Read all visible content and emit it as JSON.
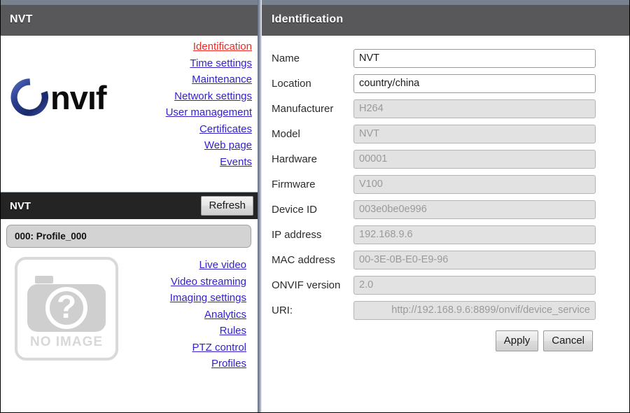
{
  "device_panel": {
    "title": "NVT",
    "logo_text": "Onvif",
    "links": [
      {
        "label": "Identification",
        "active": true
      },
      {
        "label": "Time settings",
        "active": false
      },
      {
        "label": "Maintenance",
        "active": false
      },
      {
        "label": "Network settings",
        "active": false
      },
      {
        "label": "User management",
        "active": false
      },
      {
        "label": "Certificates",
        "active": false
      },
      {
        "label": "Web page",
        "active": false
      },
      {
        "label": "Events",
        "active": false
      }
    ]
  },
  "media_panel": {
    "title": "NVT",
    "refresh_label": "Refresh",
    "profile_selected": "000: Profile_000",
    "no_image_label": "NO IMAGE",
    "links": [
      {
        "label": "Live video"
      },
      {
        "label": "Video streaming"
      },
      {
        "label": "Imaging settings"
      },
      {
        "label": "Analytics"
      },
      {
        "label": "Rules"
      },
      {
        "label": "PTZ control"
      },
      {
        "label": "Profiles"
      }
    ]
  },
  "identification": {
    "title": "Identification",
    "fields": [
      {
        "label": "Name",
        "value": "NVT",
        "readonly": false
      },
      {
        "label": "Location",
        "value": "country/china",
        "readonly": false
      },
      {
        "label": "Manufacturer",
        "value": "H264",
        "readonly": true
      },
      {
        "label": "Model",
        "value": "NVT",
        "readonly": true
      },
      {
        "label": "Hardware",
        "value": "00001",
        "readonly": true
      },
      {
        "label": "Firmware",
        "value": "V100",
        "readonly": true
      },
      {
        "label": "Device ID",
        "value": "003e0be0e996",
        "readonly": true
      },
      {
        "label": "IP address",
        "value": "192.168.9.6",
        "readonly": true
      },
      {
        "label": "MAC address",
        "value": "00-3E-0B-E0-E9-96",
        "readonly": true
      },
      {
        "label": "ONVIF version",
        "value": "2.0",
        "readonly": true
      },
      {
        "label": "URI:",
        "value": "http://192.168.9.6:8899/onvif/device_service",
        "readonly": true,
        "align_right": true
      }
    ],
    "apply_label": "Apply",
    "cancel_label": "Cancel"
  },
  "colors": {
    "header_bg": "#58585b",
    "header_top_strip": "#78828f",
    "media_header_bg": "#242424",
    "link_blue": "#3322cc",
    "link_active_red": "#ee2b24",
    "logo_blue": "#2b3f8f",
    "readonly_bg": "#e2e2e2",
    "readonly_text": "#9a9a9a",
    "placeholder_gray": "#d2d2d2"
  }
}
